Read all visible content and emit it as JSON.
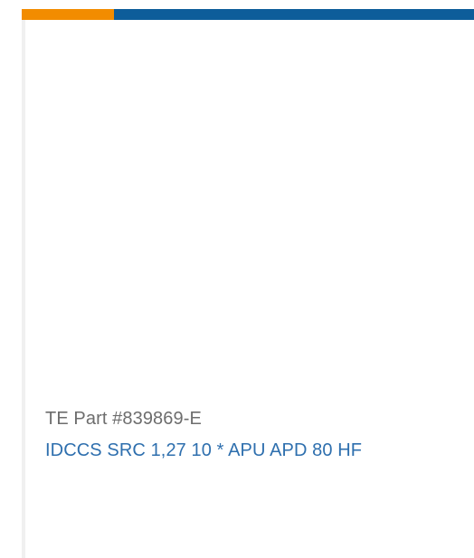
{
  "card": {
    "part_number": "TE Part #839869-E",
    "product_name": "IDCCS SRC 1,27 10 * APU APD 80 HF"
  },
  "colors": {
    "accent": "#f28c00",
    "brand": "#0d5d9a",
    "link": "#2e6fae",
    "muted_text": "#6d6d6d"
  }
}
